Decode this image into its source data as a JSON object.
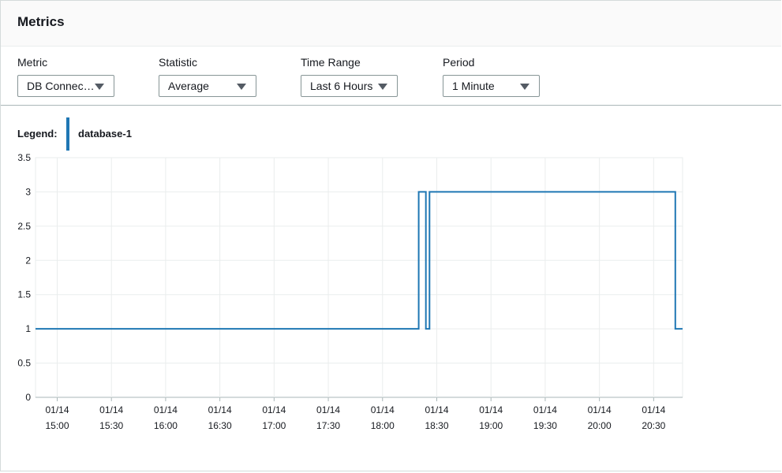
{
  "panel": {
    "title": "Metrics"
  },
  "filters": {
    "metric": {
      "label": "Metric",
      "value": "DB Connec…"
    },
    "statistic": {
      "label": "Statistic",
      "value": "Average"
    },
    "time_range": {
      "label": "Time Range",
      "value": "Last 6 Hours"
    },
    "period": {
      "label": "Period",
      "value": "1 Minute"
    }
  },
  "legend": {
    "label": "Legend:",
    "series_name": "database-1",
    "series_color": "#1f77b4"
  },
  "colors": {
    "series": "#1f77b4",
    "grid": "#eaeded",
    "axis": "#aab7b8"
  },
  "chart_data": {
    "type": "line",
    "grid": true,
    "ylim": [
      0,
      3.5
    ],
    "xlim": [
      "14:48",
      "20:46"
    ],
    "y_ticks": [
      "0",
      "0.5",
      "1",
      "1.5",
      "2",
      "2.5",
      "3",
      "3.5"
    ],
    "x_ticks": [
      {
        "time": "15:00",
        "date": "01/14"
      },
      {
        "time": "15:30",
        "date": "01/14"
      },
      {
        "time": "16:00",
        "date": "01/14"
      },
      {
        "time": "16:30",
        "date": "01/14"
      },
      {
        "time": "17:00",
        "date": "01/14"
      },
      {
        "time": "17:30",
        "date": "01/14"
      },
      {
        "time": "18:00",
        "date": "01/14"
      },
      {
        "time": "18:30",
        "date": "01/14"
      },
      {
        "time": "19:00",
        "date": "01/14"
      },
      {
        "time": "19:30",
        "date": "01/14"
      },
      {
        "time": "20:00",
        "date": "01/14"
      },
      {
        "time": "20:30",
        "date": "01/14"
      }
    ],
    "series": [
      {
        "name": "database-1",
        "color": "#1f77b4",
        "points": [
          [
            "14:48",
            1
          ],
          [
            "18:20",
            1
          ],
          [
            "18:20",
            3
          ],
          [
            "18:24",
            3
          ],
          [
            "18:24",
            1
          ],
          [
            "18:26",
            1
          ],
          [
            "18:26",
            3
          ],
          [
            "20:42",
            3
          ],
          [
            "20:42",
            1
          ],
          [
            "20:46",
            1
          ]
        ]
      }
    ]
  }
}
